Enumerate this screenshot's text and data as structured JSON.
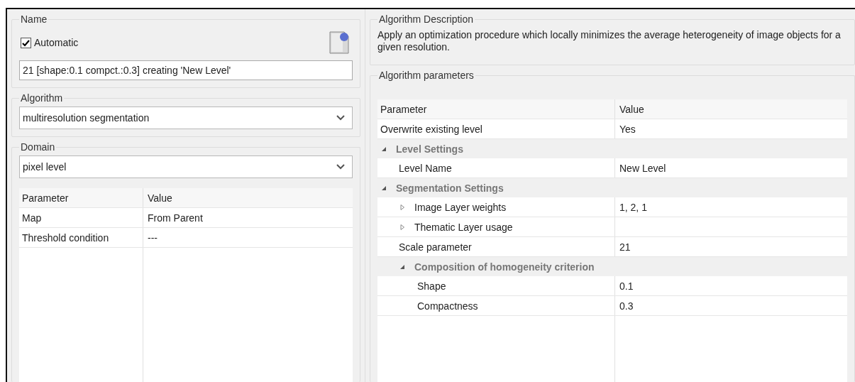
{
  "name_group": {
    "title": "Name",
    "automatic": {
      "label": "Automatic",
      "checked": true
    },
    "value": "21 [shape:0.1 compct.:0.3] creating 'New Level'"
  },
  "algorithm_group": {
    "title": "Algorithm",
    "value": "multiresolution segmentation"
  },
  "domain_group": {
    "title": "Domain",
    "value": "pixel level",
    "columns": [
      "Parameter",
      "Value"
    ],
    "rows": [
      {
        "parameter": "Map",
        "value": "From Parent"
      },
      {
        "parameter": "Threshold condition",
        "value": "---"
      }
    ]
  },
  "description_group": {
    "title": "Algorithm Description",
    "text": "Apply an optimization procedure which locally minimizes the average heterogeneity of image objects for a given resolution."
  },
  "parameters_group": {
    "title": "Algorithm parameters",
    "columns": [
      "Parameter",
      "Value"
    ],
    "items": [
      {
        "kind": "property",
        "name": "Overwrite existing level",
        "value": "Yes"
      },
      {
        "kind": "category",
        "name": "Level Settings",
        "expanded": true,
        "children": [
          {
            "kind": "property",
            "name": "Level Name",
            "value": "New Level"
          }
        ]
      },
      {
        "kind": "category",
        "name": "Segmentation Settings",
        "expanded": true,
        "children": [
          {
            "kind": "property",
            "name": "Image Layer weights",
            "value": "1, 2, 1",
            "expanded": false
          },
          {
            "kind": "property",
            "name": "Thematic Layer usage",
            "expanded": false
          },
          {
            "kind": "property",
            "name": "Scale parameter",
            "value": "21"
          },
          {
            "kind": "category",
            "name": "Composition of homogeneity criterion",
            "expanded": true,
            "children": [
              {
                "kind": "property",
                "name": "Shape",
                "value": "0.1"
              },
              {
                "kind": "property",
                "name": "Compactness",
                "value": "0.3"
              }
            ]
          }
        ]
      }
    ]
  }
}
